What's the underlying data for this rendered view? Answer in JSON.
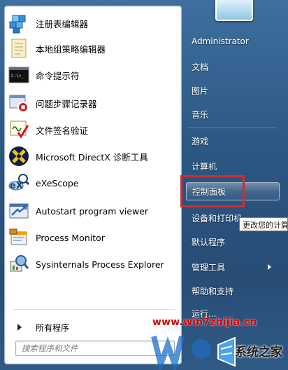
{
  "programs": [
    {
      "label": "注册表编辑器",
      "icon": "registry-editor-icon"
    },
    {
      "label": "本地组策略编辑器",
      "icon": "group-policy-icon"
    },
    {
      "label": "命令提示符",
      "icon": "command-prompt-icon"
    },
    {
      "label": "问题步骤记录器",
      "icon": "steps-recorder-icon"
    },
    {
      "label": "文件签名验证",
      "icon": "signature-verify-icon"
    },
    {
      "label": "Microsoft DirectX 诊断工具",
      "icon": "directx-icon"
    },
    {
      "label": "eXeScope",
      "icon": "exescope-icon"
    },
    {
      "label": "Autostart program viewer",
      "icon": "autostart-viewer-icon"
    },
    {
      "label": "Process Monitor",
      "icon": "process-monitor-icon"
    },
    {
      "label": "Sysinternals Process Explorer",
      "icon": "process-explorer-icon"
    }
  ],
  "all_programs_label": "所有程序",
  "search": {
    "placeholder": "搜索程序和文件"
  },
  "right_items": [
    {
      "label": "Administrator"
    },
    {
      "label": "文档"
    },
    {
      "label": "图片"
    },
    {
      "label": "音乐"
    },
    {
      "label": "游戏"
    },
    {
      "label": "计算机"
    },
    {
      "label": "控制面板"
    },
    {
      "label": "设备和打印机"
    },
    {
      "label": "默认程序"
    },
    {
      "label": "管理工具"
    },
    {
      "label": "帮助和支持"
    },
    {
      "label": "运行..."
    }
  ],
  "tooltip": "更改您的计算",
  "watermark": {
    "url": "www.win7zhijia.cn",
    "brand": "系统之家"
  },
  "colors": {
    "highlight_border": "#d22d2d",
    "menu_blue": "#2c5783"
  }
}
